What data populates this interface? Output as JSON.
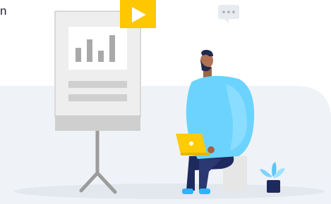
{
  "header": {
    "text_fragment": "n"
  },
  "colors": {
    "scene_bg": "#eff3f8",
    "floor_shadow": "#e3e7ee",
    "board_panel": "#eeeeee",
    "board_border": "#d7d7d7",
    "board_base": "#cfcfcf",
    "bars": "#a9a9a9",
    "play_badge": "#ffc700",
    "person_shirt": "#6cd3ff",
    "laptop": "#ffcb05",
    "pants": "#1e2a5e",
    "shoes": "#2ab5ff",
    "plant": "#7fd4ff",
    "pot": "#1e2a5e"
  },
  "icons": [
    "play-icon",
    "chat-bubble-icon",
    "bar-chart-icon",
    "laptop-icon",
    "plant-icon"
  ]
}
